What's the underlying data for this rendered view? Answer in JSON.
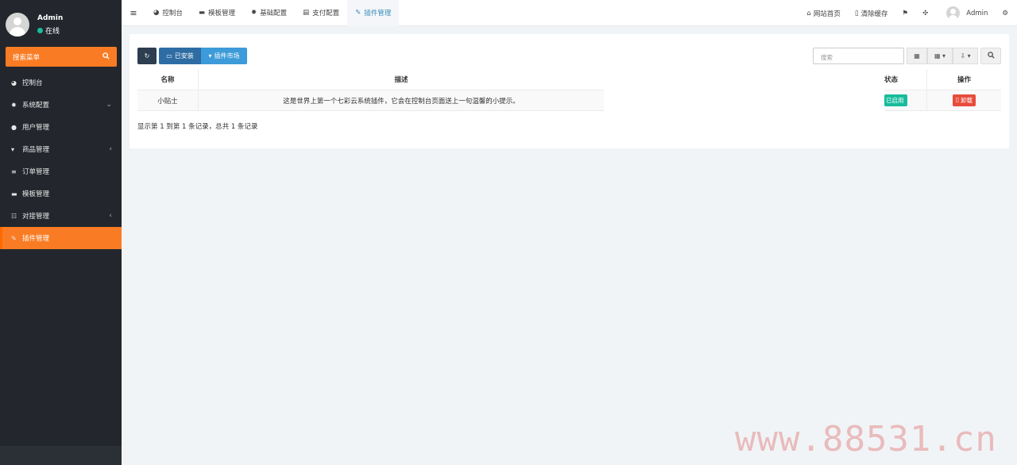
{
  "sidebar": {
    "user_name": "Admin",
    "user_status": "在线",
    "search_label": "搜索菜单",
    "items": [
      {
        "label": "控制台",
        "icon": "dashboard-icon",
        "arrow": ""
      },
      {
        "label": "系统配置",
        "icon": "gear-icon",
        "arrow": "⌄"
      },
      {
        "label": "用户管理",
        "icon": "user-icon",
        "arrow": ""
      },
      {
        "label": "商品管理",
        "icon": "cart-icon",
        "arrow": "‹"
      },
      {
        "label": "订单管理",
        "icon": "list-icon",
        "arrow": ""
      },
      {
        "label": "模板管理",
        "icon": "template-icon",
        "arrow": ""
      },
      {
        "label": "对接管理",
        "icon": "sliders-icon",
        "arrow": "‹"
      },
      {
        "label": "插件管理",
        "icon": "plugin-icon",
        "arrow": "",
        "active": true
      }
    ]
  },
  "topbar": {
    "tabs": [
      {
        "label": "控制台",
        "icon": "dashboard-icon"
      },
      {
        "label": "模板管理",
        "icon": "template-icon"
      },
      {
        "label": "基础配置",
        "icon": "gear-icon"
      },
      {
        "label": "支付配置",
        "icon": "payment-icon"
      },
      {
        "label": "插件管理",
        "icon": "plugin-icon",
        "active": true
      }
    ],
    "home_label": "网站首页",
    "clear_cache_label": "清除缓存",
    "admin_label": "Admin"
  },
  "toolbar": {
    "installed_label": "已安装",
    "market_label": "插件市场",
    "search_placeholder": "搜索"
  },
  "table": {
    "headers": {
      "name": "名称",
      "desc": "描述",
      "status": "状态",
      "op": "操作"
    },
    "rows": [
      {
        "name": "小贴士",
        "desc": "这是世界上第一个七彩云系统插件，它会在控制台页面送上一句温馨的小提示。",
        "status": "已启用",
        "op": "卸载"
      }
    ]
  },
  "pager_text": "显示第 1 到第 1 条记录，总共 1 条记录",
  "watermark": "www.88531.cn",
  "colors": {
    "accent": "#f97c24",
    "sidebar": "#23272d",
    "success": "#18bc9c",
    "danger": "#e74c3c",
    "primary": "#2e6da4"
  }
}
